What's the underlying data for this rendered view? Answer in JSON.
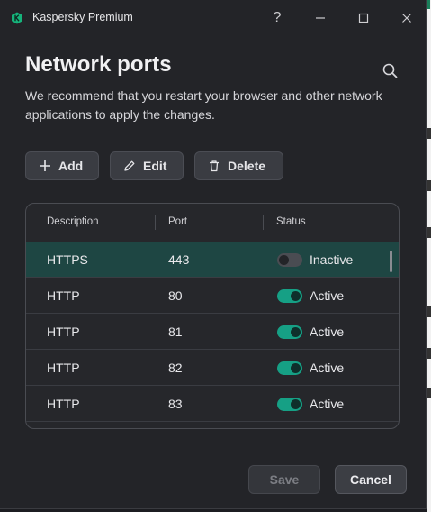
{
  "window": {
    "title": "Kaspersky Premium"
  },
  "titlebar": {
    "help_glyph": "?",
    "icons": [
      "help-icon",
      "minimize-icon",
      "maximize-icon",
      "close-icon"
    ]
  },
  "page": {
    "title": "Network ports",
    "description": "We recommend that you restart your browser and other network applications to apply the changes."
  },
  "actions": {
    "add": "Add",
    "edit": "Edit",
    "delete": "Delete"
  },
  "table": {
    "headers": {
      "description": "Description",
      "port": "Port",
      "status": "Status"
    },
    "rows": [
      {
        "description": "HTTPS",
        "port": "443",
        "status": "Inactive",
        "enabled": false,
        "selected": true
      },
      {
        "description": "HTTP",
        "port": "80",
        "status": "Active",
        "enabled": true,
        "selected": false
      },
      {
        "description": "HTTP",
        "port": "81",
        "status": "Active",
        "enabled": true,
        "selected": false
      },
      {
        "description": "HTTP",
        "port": "82",
        "status": "Active",
        "enabled": true,
        "selected": false
      },
      {
        "description": "HTTP",
        "port": "83",
        "status": "Active",
        "enabled": true,
        "selected": false
      }
    ]
  },
  "footer": {
    "save": "Save",
    "cancel": "Cancel",
    "save_enabled": false
  },
  "colors": {
    "accent": "#16a085",
    "selected_row": "#1e4643",
    "background": "#232428"
  }
}
